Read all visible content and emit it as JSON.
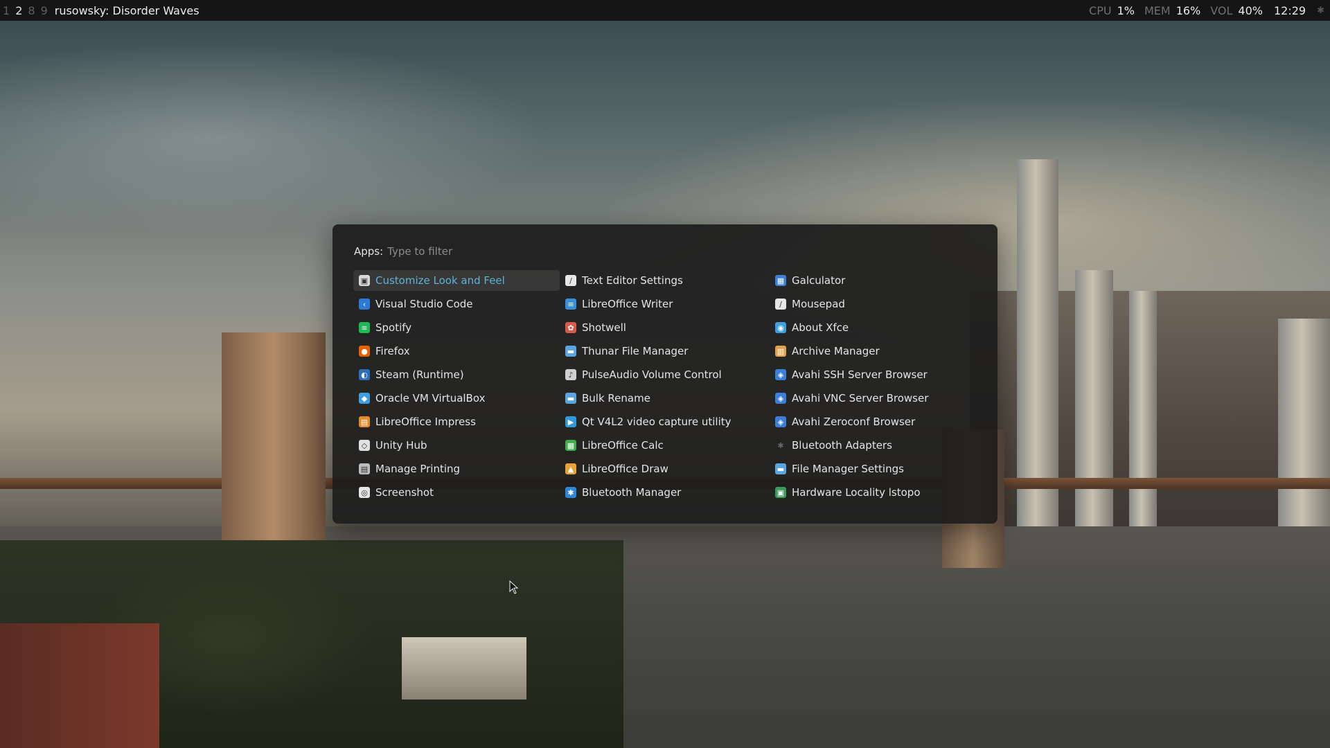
{
  "topbar": {
    "workspaces": [
      "1",
      "2",
      "8",
      "9"
    ],
    "active_workspace": "2",
    "window_title": "rusowsky: Disorder Waves",
    "cpu_label": "CPU",
    "cpu_value": "1%",
    "mem_label": "MEM",
    "mem_value": "16%",
    "vol_label": "VOL",
    "vol_value": "40%",
    "clock": "12:29",
    "tray_icon": "bluetooth-icon"
  },
  "launcher": {
    "prompt_label": "Apps:",
    "placeholder": "Type to filter",
    "selected_index": 0,
    "accent_color": "#5fb3d6",
    "items": [
      {
        "label": "Customize Look and Feel",
        "icon": "customize-icon",
        "color": "#d9d9d9"
      },
      {
        "label": "Visual Studio Code",
        "icon": "vscode-icon",
        "color": "#2c7ad6"
      },
      {
        "label": "Spotify",
        "icon": "spotify-icon",
        "color": "#1db954"
      },
      {
        "label": "Firefox",
        "icon": "firefox-icon",
        "color": "#e66000"
      },
      {
        "label": "Steam (Runtime)",
        "icon": "steam-icon",
        "color": "#2a6fb8"
      },
      {
        "label": "Oracle VM VirtualBox",
        "icon": "virtualbox-icon",
        "color": "#3d9fe0"
      },
      {
        "label": "LibreOffice Impress",
        "icon": "impress-icon",
        "color": "#e48a2a"
      },
      {
        "label": "Unity Hub",
        "icon": "unity-icon",
        "color": "#e0e0e0"
      },
      {
        "label": "Manage Printing",
        "icon": "printer-icon",
        "color": "#bdbdbd"
      },
      {
        "label": "Screenshot",
        "icon": "screenshot-icon",
        "color": "#e6e6e6"
      },
      {
        "label": "Text Editor Settings",
        "icon": "text-editor-icon",
        "color": "#e6e6e6"
      },
      {
        "label": "LibreOffice Writer",
        "icon": "writer-icon",
        "color": "#3a8fd8"
      },
      {
        "label": "Shotwell",
        "icon": "shotwell-icon",
        "color": "#d85a4a"
      },
      {
        "label": "Thunar File Manager",
        "icon": "folder-icon",
        "color": "#5aa5e0"
      },
      {
        "label": "PulseAudio Volume Control",
        "icon": "volume-icon",
        "color": "#d0d0d0"
      },
      {
        "label": "Bulk Rename",
        "icon": "bulk-rename-icon",
        "color": "#5aa5e0"
      },
      {
        "label": "Qt V4L2 video capture utility",
        "icon": "camera-icon",
        "color": "#2e9bd8"
      },
      {
        "label": "LibreOffice Calc",
        "icon": "calc-icon",
        "color": "#3fae4a"
      },
      {
        "label": "LibreOffice Draw",
        "icon": "draw-icon",
        "color": "#e8a23a"
      },
      {
        "label": "Bluetooth Manager",
        "icon": "bluetooth-icon",
        "color": "#2f86d8"
      },
      {
        "label": "Galculator",
        "icon": "calculator-icon",
        "color": "#3a7fd8"
      },
      {
        "label": "Mousepad",
        "icon": "mousepad-icon",
        "color": "#e6e6e6"
      },
      {
        "label": "About Xfce",
        "icon": "xfce-icon",
        "color": "#3d9fe0"
      },
      {
        "label": "Archive Manager",
        "icon": "archive-icon",
        "color": "#e0a24a"
      },
      {
        "label": "Avahi SSH Server Browser",
        "icon": "network-icon",
        "color": "#3a7fd8"
      },
      {
        "label": "Avahi VNC Server Browser",
        "icon": "network-icon",
        "color": "#3a7fd8"
      },
      {
        "label": "Avahi Zeroconf Browser",
        "icon": "network-icon",
        "color": "#3a7fd8"
      },
      {
        "label": "Bluetooth Adapters",
        "icon": "bluetooth-icon",
        "color": "#555555"
      },
      {
        "label": "File Manager Settings",
        "icon": "folder-settings-icon",
        "color": "#5aa5e0"
      },
      {
        "label": "Hardware Locality lstopo",
        "icon": "chip-icon",
        "color": "#3a9a5a"
      }
    ]
  }
}
